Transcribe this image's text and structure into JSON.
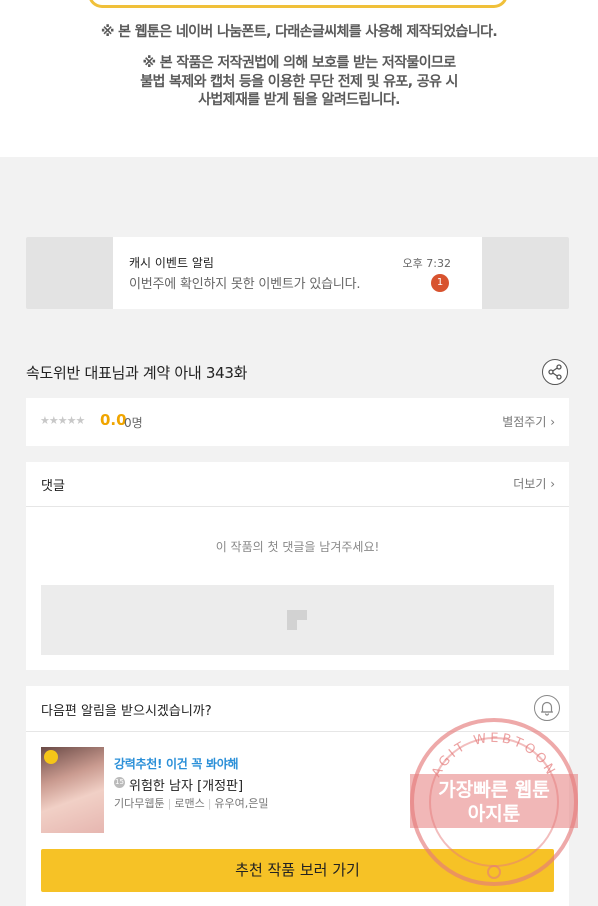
{
  "notices": {
    "font_notice": "※ 본 웹툰은 네이버 나눔폰트, 다래손글씨체를 사용해 제작되었습니다.",
    "copyright_line1": "※ 본 작품은 저작권법에 의해 보호를 받는 저작물이므로",
    "copyright_line2": "불법 복제와 캡처 등을 이용한 무단 전제 및 유포, 공유 시",
    "copyright_line3": "사법제재를 받게 됨을 알려드립니다."
  },
  "ad": {
    "title": "캐시 이벤트 알림",
    "time": "오후 7:32",
    "message": "이번주에 확인하지 못한 이벤트가 있습니다.",
    "badge_count": "1"
  },
  "episode": {
    "title": "속도위반 대표님과 계약 아내 343화",
    "share_icon": "share-icon"
  },
  "rating": {
    "stars": "★★★★★",
    "score": "0.0",
    "people": "0명",
    "rate_link": "별점주기 ›"
  },
  "comments": {
    "title": "댓글",
    "more": "더보기 ›",
    "empty_message": "이 작품의 첫 댓글을 남겨주세요!"
  },
  "next": {
    "question": "다음편 알림을 받으시겠습니까?",
    "recommend_tag": "강력추천! 이건 꼭 봐야해",
    "age_badge": "15",
    "work_title": "위험한 남자 [개정판]",
    "genre": "기다무웹툰",
    "category": "로맨스",
    "authors": "유우여,은밀",
    "cta": "추천 작품 보러 가기"
  },
  "stamp": {
    "ring_text": "AGIT WEBTOON",
    "line1": "가장빠른 웹툰",
    "line2": "아지툰"
  },
  "colors": {
    "accent_yellow": "#f6c226",
    "score_orange": "#f0a500",
    "link_blue": "#2a8fd8",
    "badge_red": "#d8532f"
  }
}
